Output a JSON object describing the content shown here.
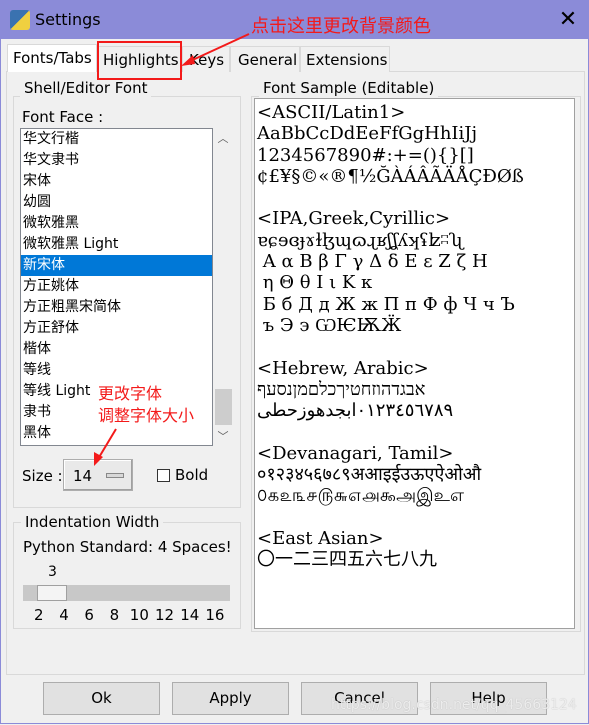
{
  "window": {
    "title": "Settings",
    "close_icon": "close-icon"
  },
  "tabs": [
    {
      "label": "Fonts/Tabs",
      "active": true
    },
    {
      "label": "Highlights"
    },
    {
      "label": "Keys"
    },
    {
      "label": "General"
    },
    {
      "label": "Extensions"
    }
  ],
  "font_group": {
    "legend": "Shell/Editor Font",
    "font_face_label": "Font Face :",
    "fonts": [
      "华文行楷",
      "华文隶书",
      "宋体",
      "幼圆",
      "微软雅黑",
      "微软雅黑 Light",
      "新宋体",
      "方正姚体",
      "方正粗黑宋简体",
      "方正舒体",
      "楷体",
      "等线",
      "等线 Light",
      "隶书",
      "黑体"
    ],
    "selected_font": "新宋体",
    "size_label": "Size :",
    "size_value": "14",
    "bold_label": "Bold",
    "bold_checked": false
  },
  "indent_group": {
    "legend": "Indentation Width",
    "note": "Python Standard: 4 Spaces!",
    "value": "3",
    "ticks": [
      "2",
      "4",
      "6",
      "8",
      "10",
      "12",
      "14",
      "16"
    ]
  },
  "sample": {
    "legend": "Font Sample (Editable)",
    "text": "<ASCII/Latin1>\nAaBbCcDdEeFfGgHhIiJj\n1234567890#:+=(){}[]\n¢£¥§©«®¶½ĞÀÁÂÃÄÅÇÐØß\n\n<IPA,Greek,Cyrillic>\nɐɕɘɞɟɤɫɮɰɷɻʁʃʆʎʞʢʫʭʯ\n Α α Β β Γ γ Δ δ Ε ε Ζ ζ Η\n η Θ θ Ι ι Κ κ\n Б б Д д Ж ж П п Ф ф Ч ч Ъ\n ъ Э э ѠѤѬӜ\n\n<Hebrew, Arabic>\nאבגדהוזחטיךכלםמןנסעף\n٠١٢٣٤٥٦٧٨٩ابجدهوزحطی\n\n<Devanagari, Tamil>\n०१२३४५६७८९अआइईउऊएऐओऔ\n௦௧௨௩௪௫௬௭௮௯அஇஉஎ\n\n<East Asian>\n〇一二三四五六七八九"
  },
  "buttons": {
    "ok": "Ok",
    "apply": "Apply",
    "cancel": "Cancel",
    "help": "Help"
  },
  "annotations": {
    "highlights_note": "点击这里更改背景颜色",
    "font_note": "更改字体",
    "size_note": "调整字体大小",
    "color": "#f31a1a"
  },
  "watermark": "https://blog.csdn.net/qq_45663124"
}
